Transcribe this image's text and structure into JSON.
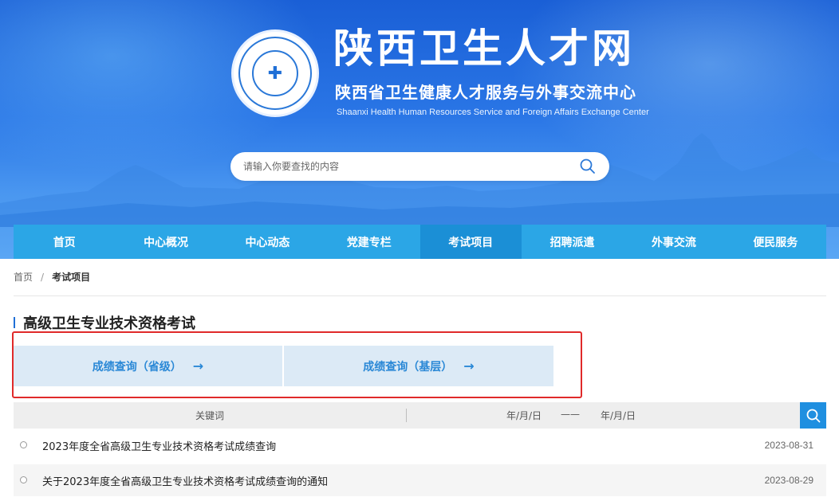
{
  "header": {
    "title": "陕西卫生人才网",
    "subtitle": "陕西省卫生健康人才服务与外事交流中心",
    "subtitle_en": "Shaanxi Health Human Resources Service and Foreign Affairs Exchange Center",
    "logo_icon": "emblem-logo",
    "search_placeholder": "请输入你要查找的内容",
    "search_icon": "search-icon"
  },
  "nav": {
    "items": [
      {
        "label": "首页"
      },
      {
        "label": "中心概况"
      },
      {
        "label": "中心动态"
      },
      {
        "label": "党建专栏"
      },
      {
        "label": "考试项目",
        "active": true
      },
      {
        "label": "招聘派遣"
      },
      {
        "label": "外事交流"
      },
      {
        "label": "便民服务"
      }
    ]
  },
  "breadcrumb": {
    "home": "首页",
    "separator": "/",
    "current": "考试项目"
  },
  "section": {
    "title": "高级卫生专业技术资格考试"
  },
  "query_buttons": [
    {
      "label": "成绩查询（省级）",
      "arrow": "→"
    },
    {
      "label": "成绩查询（基层）",
      "arrow": "→"
    }
  ],
  "filter": {
    "keyword_placeholder": "关键词",
    "date_start_placeholder": "年/月/日",
    "date_end_placeholder": "年/月/日",
    "dash": "——"
  },
  "list": [
    {
      "title": "2023年度全省高级卫生专业技术资格考试成绩查询",
      "date": "2023-08-31"
    },
    {
      "title": "关于2023年度全省高级卫生专业技术资格考试成绩查询的通知",
      "date": "2023-08-29"
    }
  ],
  "colors": {
    "nav_bg": "#2ba6e6",
    "nav_active": "#1b8fd6",
    "highlight_border": "#e02a2a",
    "query_button_bg": "#dceaf6",
    "query_button_text": "#2a88d6"
  }
}
